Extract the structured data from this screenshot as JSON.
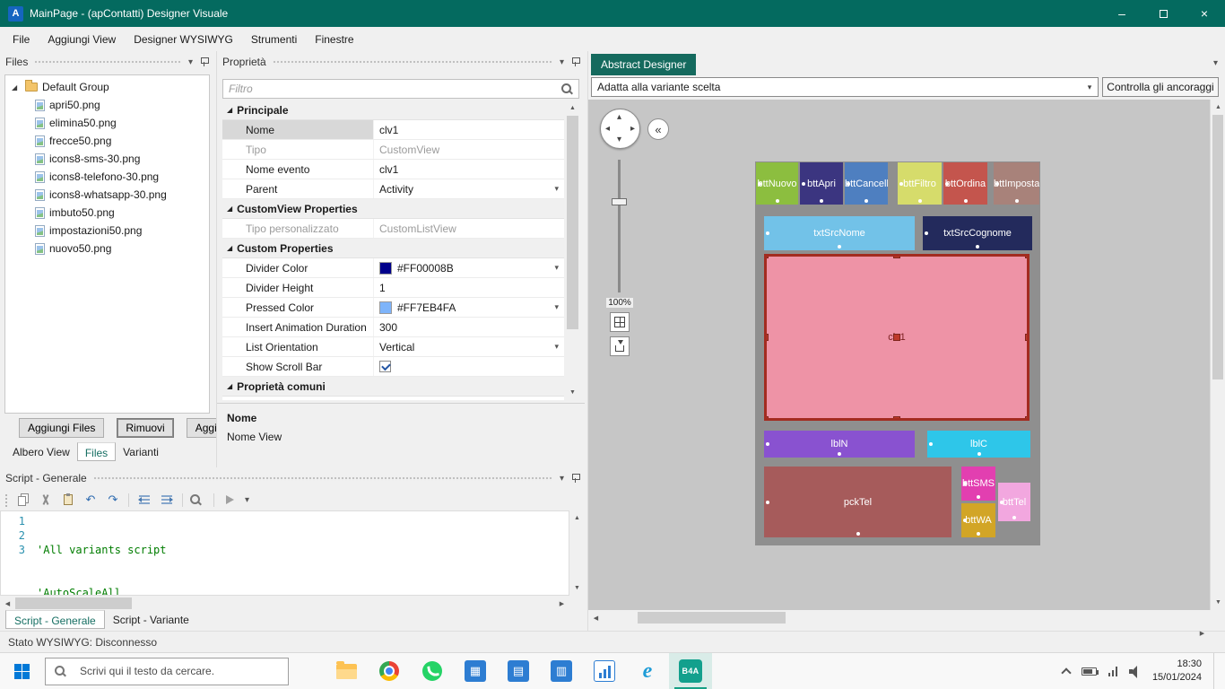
{
  "titlebar": {
    "app_letter": "A",
    "title": "MainPage - (apContatti) Designer Visuale"
  },
  "menubar": {
    "items": [
      "File",
      "Aggiungi View",
      "Designer WYSIWYG",
      "Strumenti",
      "Finestre"
    ]
  },
  "files_panel": {
    "title": "Files",
    "group_label": "Default Group",
    "files": [
      "apri50.png",
      "elimina50.png",
      "frecce50.png",
      "icons8-sms-30.png",
      "icons8-telefono-30.png",
      "icons8-whatsapp-30.png",
      "imbuto50.png",
      "impostazioni50.png",
      "nuovo50.png"
    ],
    "buttons": {
      "add": "Aggiungi Files",
      "remove": "Rimuovi",
      "update": "Aggiorn"
    },
    "tabs": [
      "Albero View",
      "Files",
      "Varianti"
    ],
    "active_tab": "Files"
  },
  "properties_panel": {
    "title": "Proprietà",
    "filter_placeholder": "Filtro",
    "sections": {
      "principale": {
        "header": "Principale",
        "rows": [
          {
            "label": "Nome",
            "value": "clv1"
          },
          {
            "label": "Tipo",
            "value": "CustomView"
          },
          {
            "label": "Nome evento",
            "value": "clv1"
          },
          {
            "label": "Parent",
            "value": "Activity"
          }
        ]
      },
      "customview": {
        "header": "CustomView Properties",
        "rows": [
          {
            "label": "Tipo personalizzato",
            "value": "CustomListView"
          }
        ]
      },
      "custom": {
        "header": "Custom Properties",
        "rows": [
          {
            "label": "Divider Color",
            "value": "#FF00008B",
            "swatch": "#00008B"
          },
          {
            "label": "Divider Height",
            "value": "1"
          },
          {
            "label": "Pressed Color",
            "value": "#FF7EB4FA",
            "swatch": "#7EB4FA"
          },
          {
            "label": "Insert Animation Duration",
            "value": "300"
          },
          {
            "label": "List Orientation",
            "value": "Vertical"
          },
          {
            "label": "Show Scroll Bar",
            "checked": true
          }
        ]
      },
      "comuni": {
        "header": "Proprietà comuni"
      }
    },
    "description": {
      "title": "Nome",
      "text": "Nome View"
    }
  },
  "script_panel": {
    "title": "Script - Generale",
    "lines": [
      {
        "num": "1",
        "code": "'All variants script"
      },
      {
        "num": "2",
        "code": "'AutoScaleAll"
      },
      {
        "num": "3",
        "code": ""
      }
    ],
    "tabs": [
      "Script - Generale",
      "Script - Variante"
    ]
  },
  "designer_panel": {
    "tab": "Abstract Designer",
    "variant_selector": "Adatta alla variante scelta",
    "anchors_button": "Controlla gli ancoraggi",
    "zoom_label": "100%",
    "controls": [
      {
        "name": "bttNuovo",
        "color": "#8cbe3f"
      },
      {
        "name": "bttApri",
        "color": "#3b3580"
      },
      {
        "name": "bttCancella",
        "color": "#4e7fc0"
      },
      {
        "name": "bttFiltro",
        "color": "#d6dc6b"
      },
      {
        "name": "bttOrdina",
        "color": "#c4554d"
      },
      {
        "name": "bttImpostazioni",
        "color": "#a8827a"
      },
      {
        "name": "txtSrcNome",
        "color": "#72c2e8"
      },
      {
        "name": "txtSrcCognome",
        "color": "#232a5c"
      },
      {
        "name": "clv1",
        "color": "#ee93a6"
      },
      {
        "name": "lblN",
        "color": "#8952d0"
      },
      {
        "name": "lblC",
        "color": "#2ec6e9"
      },
      {
        "name": "pckTel",
        "color": "#a65b5b"
      },
      {
        "name": "bttSMS",
        "color": "#e23fb0"
      },
      {
        "name": "bttTel",
        "color": "#f2a7df"
      },
      {
        "name": "bttWA",
        "color": "#d2a526"
      }
    ],
    "selection_color": "#bf3a2b"
  },
  "statusbar": {
    "text": "Stato WYSIWYG: Disconnesso"
  },
  "taskbar": {
    "search_placeholder": "Scrivi qui il testo da cercare.",
    "b4a_label": "B4A",
    "clock": {
      "time": "18:30",
      "date": "15/01/2024"
    }
  },
  "icons": {
    "caret_down": "▾",
    "tree_expanded": "◢",
    "section_expanded": "◢",
    "minimize": "–",
    "close": "×",
    "collapse_left": "«",
    "undo": "↶",
    "redo": "↷",
    "nav_up": "▴",
    "nav_down": "▾",
    "nav_left": "◂",
    "nav_right": "▸",
    "scroll_up": "▲",
    "scroll_down": "▼",
    "scroll_left": "◀",
    "scroll_right": "▶"
  }
}
